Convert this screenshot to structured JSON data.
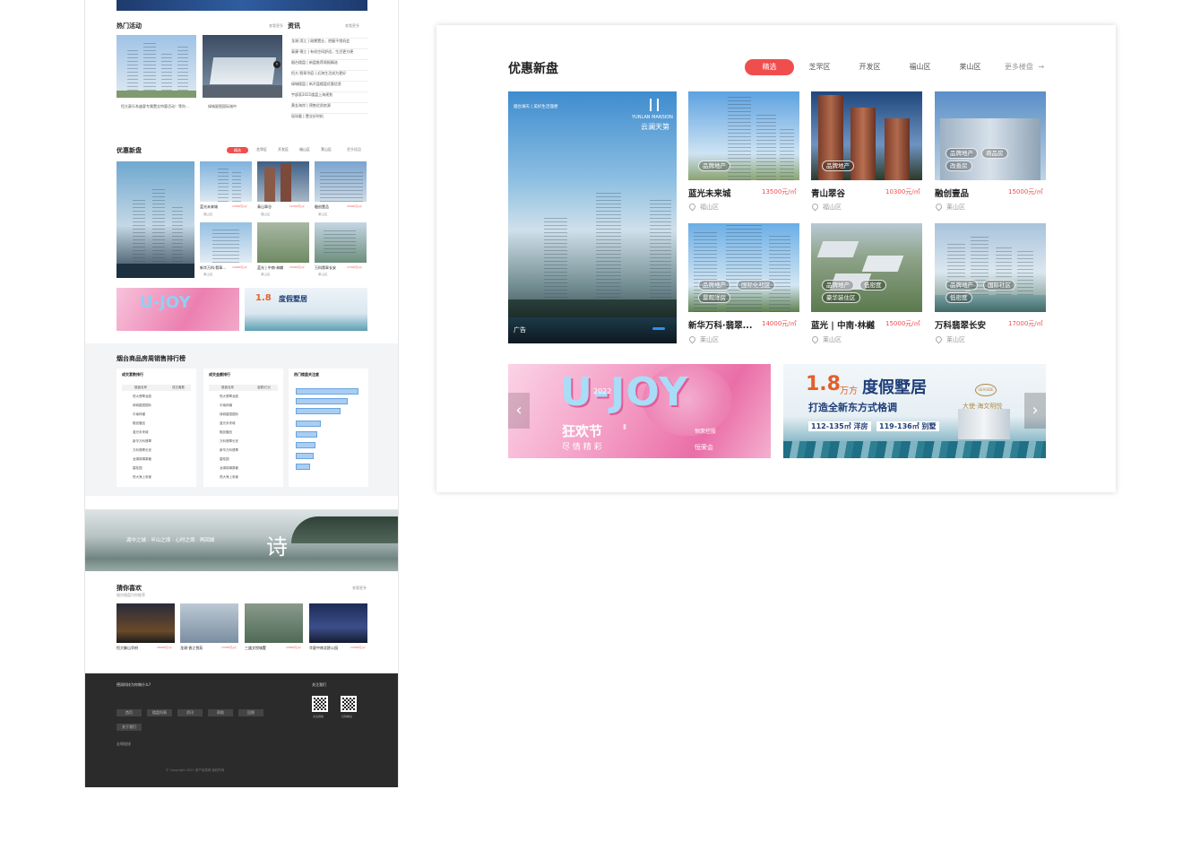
{
  "left_preview": {
    "hot_title": "热门活动",
    "news_title": "资讯",
    "more_label": "查看更多",
    "hot_items": [
      {
        "title": "恒大豪乐系盛夏专属置业特惠活动！等你..."
      },
      {
        "title": "绿城星图国际城中"
      }
    ],
    "news_lines": [
      "龙湖·滨江 | 刚需置业，把握不错机会",
      "泰康·锦江 | 有机空间舒适，生活更方便",
      "烟台楼盘 | 新盘推荐周报精选",
      "恒大·翡翠华庭 | 近海生活成为更好",
      "绿城楼盘 | 新开盘楼盘优惠信息",
      "宇部家2021楼盘上海规划",
      "黄金海岸 | 预售优质房源",
      "现场看 | 置业好时机"
    ],
    "discount_title": "优惠新盘",
    "tabs": [
      "精选",
      "芝罘区",
      "开发区",
      "福山区",
      "莱山区"
    ],
    "mini_cards": [
      {
        "name": "蓝光未来城",
        "price": "13500元/㎡",
        "district": "福山区"
      },
      {
        "name": "青山翠谷",
        "price": "10300元/㎡",
        "district": "福山区"
      },
      {
        "name": "融创壹品",
        "price": "15000元/㎡",
        "district": "莱山区"
      },
      {
        "name": "新华万科·翡翠...",
        "price": "14000元/㎡",
        "district": "莱山区"
      },
      {
        "name": "蓝光 | 中南·林樾",
        "price": "15000元/㎡",
        "district": "莱山区"
      },
      {
        "name": "万科翡翠长安",
        "price": "17000元/㎡",
        "district": "莱山区"
      }
    ],
    "ranking_title": "烟台商品房周销售排行榜",
    "rank_col1": "成交套数排行",
    "rank_col2": "成交金额排行",
    "rank_col3": "热门楼盘关注度",
    "rank_head_a": "楼盘名称",
    "rank_head_b": "成交套数",
    "rank_head_c": "金额/亿元",
    "rank_rows": [
      "恒大翡翠龙庭",
      "绿城星图国际",
      "中南林樾",
      "融创壹品",
      "蓝光未来城",
      "新华万科翡翠",
      "万科翡翠长安",
      "龙湖锦璘原著",
      "碧桂园",
      "恒大海上帝景"
    ],
    "banner_text": "湖中之城 · 半山之境 · 心时之境 · 再回城",
    "banner_glyph": "诗",
    "guess_title": "猜你喜欢",
    "guess_sub": "烟台楼盘为你推荐",
    "guess_items": [
      {
        "name": "恒大御山华府",
        "price": "16900元/㎡"
      },
      {
        "name": "龙湖·香江悦苑",
        "price": "13300元/㎡"
      },
      {
        "name": "三盛文悦城墅",
        "price": "12800元/㎡"
      },
      {
        "name": "华夏中南北欧公园",
        "price": "14300元/㎡"
      }
    ],
    "footer_q": "德润科技为你做什么?",
    "footer_follow": "关注我们",
    "footer_buttons": [
      "首页",
      "楼盘列表",
      "资讯",
      "帮助",
      "回馈",
      "关于我们"
    ],
    "footer_qr1": "关注微信",
    "footer_qr2": "扫码看房",
    "footer_links": "友情链接",
    "footer_copy": "© Copyright 2021 房产信息网 版权所有"
  },
  "main": {
    "title": "优惠新盘",
    "tabs": [
      {
        "label": "精选",
        "active": true
      },
      {
        "label": "芝罘区",
        "active": false
      },
      {
        "label": "开发区",
        "active": false
      },
      {
        "label": "福山区",
        "active": false
      },
      {
        "label": "莱山区",
        "active": false
      }
    ],
    "more": "更多楼盘",
    "featured": {
      "brand_en": "YUNLAN MANSION",
      "brand_cn": "云澜天第",
      "top_text": "烟台澜天  |  美好生活理想",
      "ad_label": "广告"
    },
    "cards": [
      {
        "name": "蓝光未来城",
        "price": "13500元/㎡",
        "district": "福山区",
        "tags": [
          "品牌地产"
        ]
      },
      {
        "name": "青山翠谷",
        "price": "10300元/㎡",
        "district": "福山区",
        "tags": [
          "品牌地产"
        ]
      },
      {
        "name": "融创壹品",
        "price": "15000元/㎡",
        "district": "莱山区",
        "tags": [
          "品牌地产",
          "商品房",
          "改善房"
        ]
      },
      {
        "name": "新华万科·翡翠...",
        "price": "14000元/㎡",
        "district": "莱山区",
        "tags": [
          "品牌地产",
          "国际化社区",
          "景观洋房"
        ]
      },
      {
        "name": "蓝光 | 中南·林樾",
        "price": "15000元/㎡",
        "district": "莱山区",
        "tags": [
          "品牌地产",
          "低密度",
          "豪华装住区"
        ]
      },
      {
        "name": "万科翡翠长安",
        "price": "17000元/㎡",
        "district": "莱山区",
        "tags": [
          "品牌地产",
          "国际社区",
          "低密度"
        ]
      }
    ],
    "banner_left": {
      "title": "U-JOY",
      "year": "2022",
      "sub1": "狂欢节",
      "sub_mark": "Ⅱ",
      "sub2": "尽 情 精 彩",
      "brand": "恒荣控股",
      "brand2": "恒荣会"
    },
    "banner_right": {
      "num": "1.8",
      "unit": "万方",
      "title": "度假墅居",
      "sub": "打造全新东方式格调",
      "spec1": "112-135㎡ 洋房",
      "spec2": "119-136㎡ 别墅",
      "brand": "大使·海文明悦",
      "seal": "SEASIDE"
    }
  },
  "colors": {
    "accent": "#f04d4d",
    "footer_bg": "#2b2b2b",
    "pink": "#f3a0c4",
    "blue": "#2f6fb6"
  }
}
